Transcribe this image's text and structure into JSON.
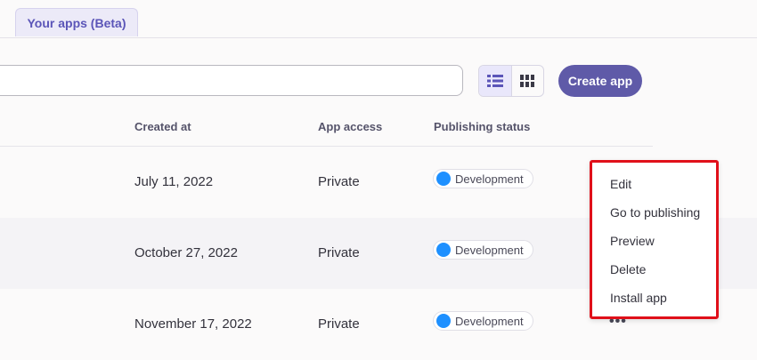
{
  "tabs": [
    {
      "label": "Your apps (Beta)",
      "active": true
    }
  ],
  "search": {
    "placeholder": "",
    "value": ""
  },
  "view_toggle": {
    "active": "list",
    "options": [
      "list-icon",
      "grid-icon"
    ]
  },
  "toolbar": {
    "create_label": "Create app"
  },
  "table": {
    "columns": [
      "Created at",
      "App access",
      "Publishing status"
    ],
    "rows": [
      {
        "created": "July 11, 2022",
        "access": "Private",
        "status": "Development"
      },
      {
        "created": "October 27, 2022",
        "access": "Private",
        "status": "Development"
      },
      {
        "created": "November 17, 2022",
        "access": "Private",
        "status": "Development"
      }
    ]
  },
  "context_menu": {
    "items": [
      "Edit",
      "Go to publishing",
      "Preview",
      "Delete",
      "Install app"
    ]
  },
  "colors": {
    "accent": "#5f5aa8",
    "status_dot": "#1e90ff",
    "highlight_border": "#e0101a"
  },
  "more_icon": "more-horizontal-icon"
}
